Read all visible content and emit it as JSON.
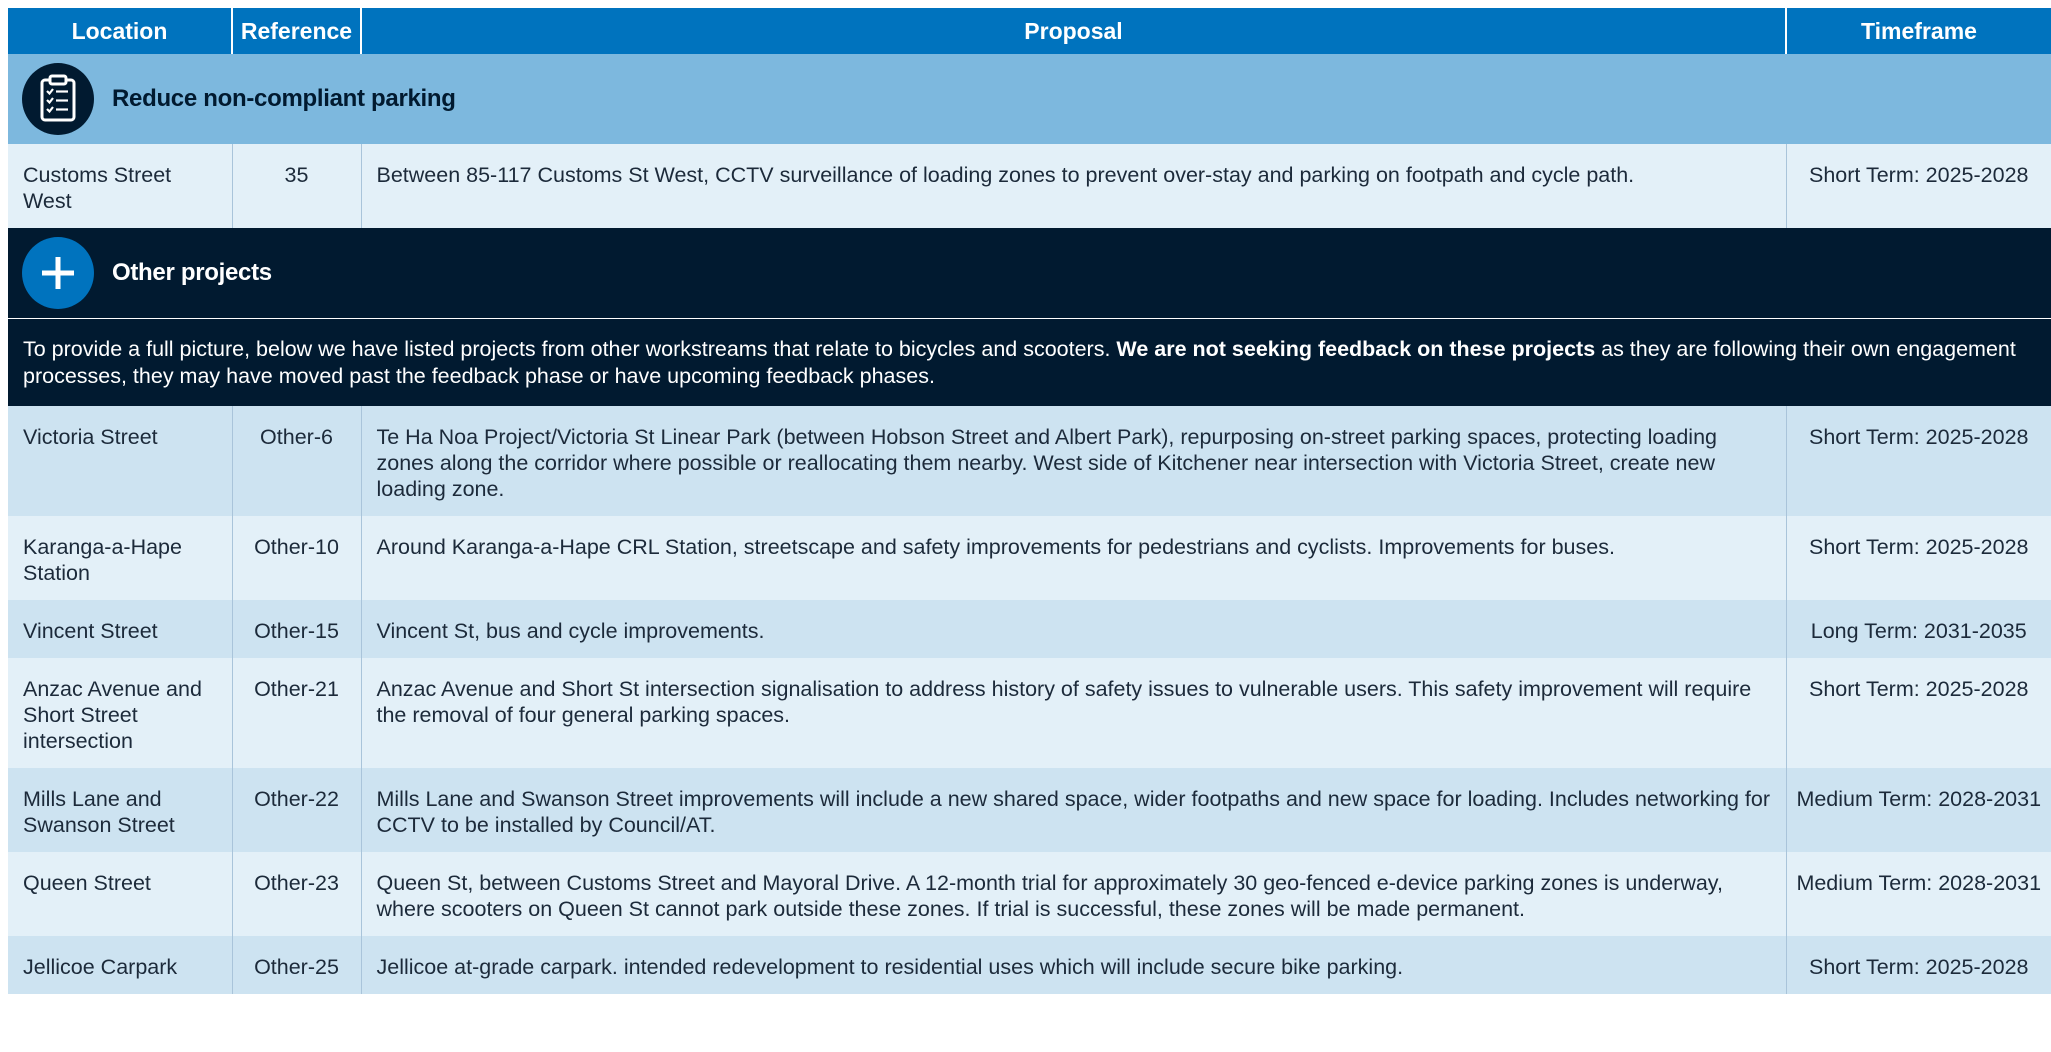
{
  "headers": {
    "location": "Location",
    "reference": "Reference",
    "proposal": "Proposal",
    "timeframe": "Timeframe"
  },
  "section_parking": {
    "title": "Reduce non-compliant parking",
    "icon": "clipboard-checklist-icon",
    "rows": [
      {
        "location": "Customs Street West",
        "reference": "35",
        "proposal": "Between 85-117 Customs St West, CCTV surveillance of loading zones to prevent over-stay and parking on footpath and cycle path.",
        "timeframe": "Short Term: 2025-2028"
      }
    ]
  },
  "section_other": {
    "title": "Other projects",
    "icon": "plus-icon",
    "intro_before": "To provide a full picture, below we have listed projects from other workstreams that relate to bicycles and scooters. ",
    "intro_bold": "We are not seeking feedback on these projects",
    "intro_after": " as they are following their own engagement processes, they may have moved past the feedback phase or have upcoming feedback phases.",
    "rows": [
      {
        "location": "Victoria Street",
        "reference": "Other-6",
        "proposal": "Te Ha Noa Project/Victoria St Linear Park (between Hobson Street and Albert Park), repurposing on-street parking spaces, protecting loading zones along the corridor where possible or reallocating them nearby. West side of Kitchener near intersection with Victoria Street, create new loading zone.",
        "timeframe": "Short Term: 2025-2028"
      },
      {
        "location": "Karanga-a-Hape Station",
        "reference": "Other-10",
        "proposal": "Around Karanga-a-Hape CRL Station, streetscape and safety improvements for pedestrians and cyclists. Improvements for buses.",
        "timeframe": "Short Term: 2025-2028"
      },
      {
        "location": "Vincent Street",
        "reference": "Other-15",
        "proposal": "Vincent St, bus and cycle improvements.",
        "timeframe": "Long Term: 2031-2035"
      },
      {
        "location": "Anzac Avenue and Short Street intersection",
        "reference": "Other-21",
        "proposal": "Anzac Avenue and Short St intersection signalisation to address history of safety issues to vulnerable users. This safety improvement will require the removal of four general parking spaces.",
        "timeframe": "Short Term: 2025-2028"
      },
      {
        "location": "Mills Lane and Swanson Street",
        "reference": "Other-22",
        "proposal": "Mills Lane and Swanson Street improvements will include a new shared space, wider footpaths and new space for loading. Includes networking for CCTV to be installed by Council/AT.",
        "timeframe": "Medium Term: 2028-2031"
      },
      {
        "location": "Queen Street",
        "reference": "Other-23",
        "proposal": "Queen St, between Customs Street and Mayoral Drive. A 12-month trial for approximately 30 geo-fenced e-device parking zones is underway, where scooters on Queen St cannot park outside these zones. If trial is successful, these zones will be made permanent.",
        "timeframe": "Medium Term: 2028-2031"
      },
      {
        "location": "Jellicoe Carpark",
        "reference": "Other-25",
        "proposal": "Jellicoe at-grade carpark. intended redevelopment to residential uses which will include secure bike parking.",
        "timeframe": "Short Term: 2025-2028"
      }
    ]
  },
  "colors": {
    "header_blue": "#0073be",
    "section_light_blue": "#7db8de",
    "section_dark_navy": "#011a30",
    "row_light": "#e3f0f8",
    "row_mid": "#cde3f1"
  }
}
